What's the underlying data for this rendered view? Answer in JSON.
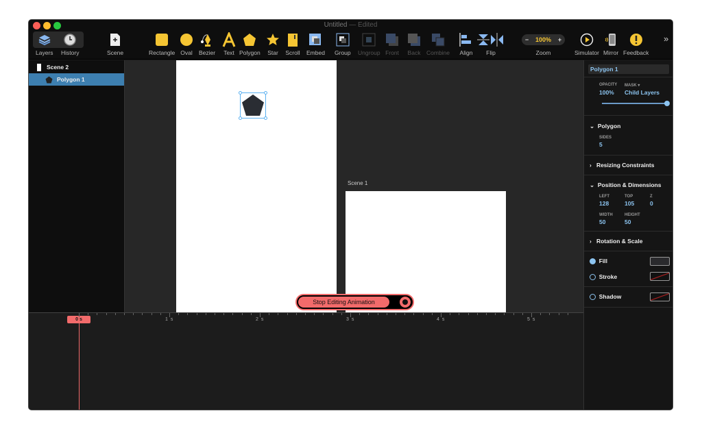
{
  "window": {
    "title": "Untitled",
    "status": "— Edited"
  },
  "toolbar": {
    "left": [
      {
        "id": "layers",
        "label": "Layers"
      },
      {
        "id": "history",
        "label": "History"
      }
    ],
    "scene": "Scene",
    "tools": [
      {
        "id": "rectangle",
        "label": "Rectangle"
      },
      {
        "id": "oval",
        "label": "Oval"
      },
      {
        "id": "bezier",
        "label": "Bezier"
      },
      {
        "id": "text",
        "label": "Text"
      },
      {
        "id": "polygon",
        "label": "Polygon"
      },
      {
        "id": "star",
        "label": "Star"
      },
      {
        "id": "scroll",
        "label": "Scroll"
      },
      {
        "id": "embed",
        "label": "Embed"
      },
      {
        "id": "group",
        "label": "Group"
      },
      {
        "id": "ungroup",
        "label": "Ungroup"
      },
      {
        "id": "front",
        "label": "Front"
      },
      {
        "id": "back",
        "label": "Back"
      },
      {
        "id": "combine",
        "label": "Combine"
      },
      {
        "id": "align",
        "label": "Align"
      },
      {
        "id": "flip",
        "label": "Flip"
      }
    ],
    "zoom": {
      "label": "Zoom",
      "value": "100%",
      "minus": "−",
      "plus": "+"
    },
    "right": [
      {
        "id": "simulator",
        "label": "Simulator"
      },
      {
        "id": "mirror",
        "label": "Mirror"
      },
      {
        "id": "feedback",
        "label": "Feedback"
      }
    ],
    "overflow": "»"
  },
  "layers": [
    {
      "name": "Scene 2",
      "icon": "artboard-icon"
    },
    {
      "name": "Polygon 1",
      "icon": "pentagon-icon",
      "selected": true
    }
  ],
  "canvas": {
    "scene1_label": "Scene 1",
    "stop_button": "Stop Editing Animation"
  },
  "inspector": {
    "name": "Polygon 1",
    "opacity_label": "OPACITY",
    "opacity": "100%",
    "mask_label": "MASK ▾",
    "mask": "Child Layers",
    "opacity_fraction": 1.0,
    "polygon": {
      "title": "Polygon",
      "sides_label": "SIDES",
      "sides": "5"
    },
    "resizing": "Resizing Constraints",
    "position": {
      "title": "Position & Dimensions",
      "left_label": "LEFT",
      "left": "128",
      "top_label": "TOP",
      "top": "105",
      "z_label": "Z",
      "z": "0",
      "width_label": "WIDTH",
      "width": "50",
      "height_label": "HEIGHT",
      "height": "50"
    },
    "rotation": "Rotation & Scale",
    "fill": "Fill",
    "stroke": "Stroke",
    "shadow": "Shadow"
  },
  "timeline": {
    "playhead": "0 s",
    "labels": [
      "1 s",
      "2 s",
      "3 s",
      "4 s",
      "5 s"
    ]
  },
  "colors": {
    "accent": "#f5c533",
    "selection": "#3d7fb0",
    "blue_text": "#8cc4f0",
    "record": "#f26b6b"
  }
}
